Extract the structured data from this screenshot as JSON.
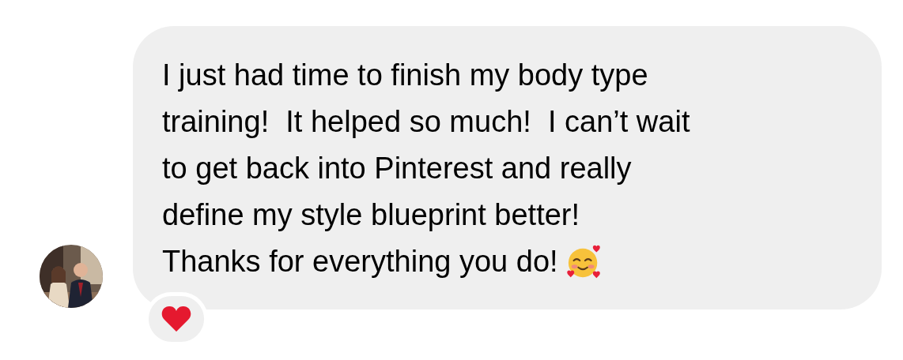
{
  "message": {
    "lines": [
      "I just had time to finish my body type",
      "training!  It helped so much!  I can’t wait",
      "to get back into Pinterest and really",
      "define my style blueprint better!",
      "Thanks for everything you do!"
    ]
  }
}
